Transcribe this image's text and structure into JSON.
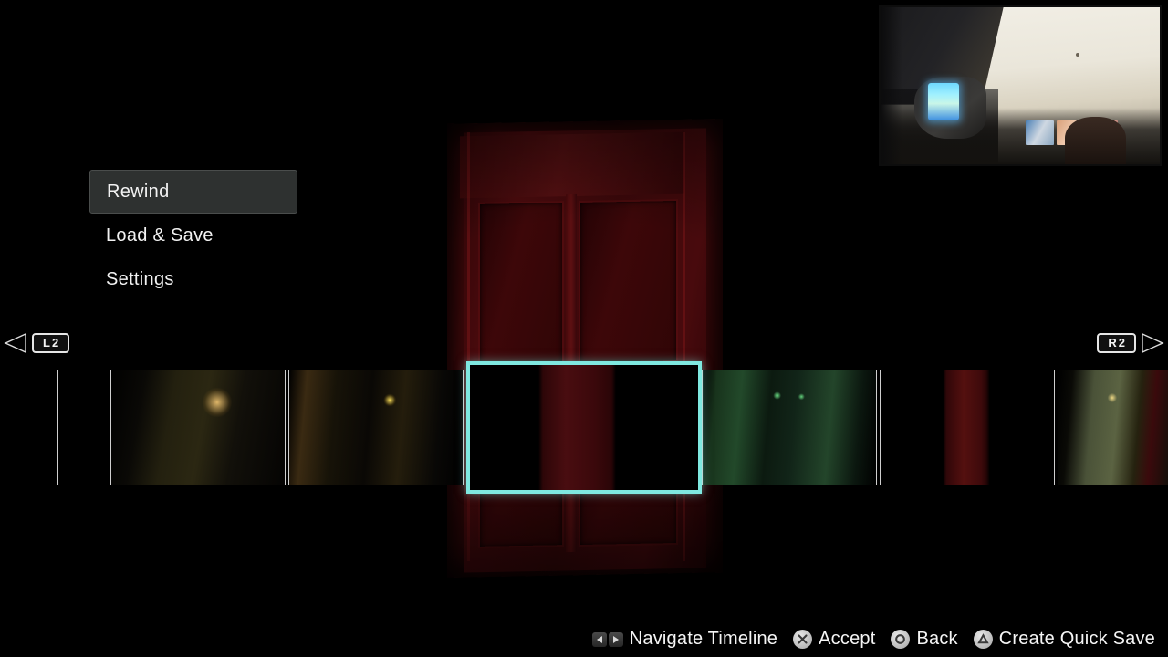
{
  "menu": {
    "items": [
      {
        "label": "Rewind",
        "selected": true
      },
      {
        "label": "Load & Save",
        "selected": false
      },
      {
        "label": "Settings",
        "selected": false
      }
    ]
  },
  "shoulder_hints": {
    "left": {
      "label": "L2",
      "icon": "triangle-left-icon"
    },
    "right": {
      "label": "R2",
      "icon": "triangle-right-icon"
    }
  },
  "timeline": {
    "selected_index": 3,
    "thumbnails": [
      {
        "scene": "tscene-empty",
        "description": "black frame (partially offscreen left)"
      },
      {
        "scene": "tscene-dark-room",
        "description": "dark room with warm hanging lamp"
      },
      {
        "scene": "tscene-hall-lamp",
        "description": "dim hallway with small yellow light"
      },
      {
        "scene": "tscene-door-dark",
        "description": "dark red panelled door, current frame"
      },
      {
        "scene": "tscene-green-hall",
        "description": "green tinted corridor with lights"
      },
      {
        "scene": "tscene-red-door",
        "description": "dark red door centred in black room"
      },
      {
        "scene": "tscene-corridor",
        "description": "corridor with wall sconces and red door"
      }
    ]
  },
  "footer": {
    "prompts": [
      {
        "icon": "dpad-left-right-icon",
        "label": "Navigate Timeline"
      },
      {
        "icon": "cross-button-icon",
        "label": "Accept"
      },
      {
        "icon": "circle-button-icon",
        "label": "Back"
      },
      {
        "icon": "triangle-button-icon",
        "label": "Create Quick Save"
      }
    ]
  },
  "webcam": {
    "label": "webcam-overlay"
  },
  "colors": {
    "selection_cyan": "#7fe8e0",
    "menu_highlight": "#2e3130",
    "text": "#f5f5f5",
    "door_red": "#4d0b0e"
  }
}
